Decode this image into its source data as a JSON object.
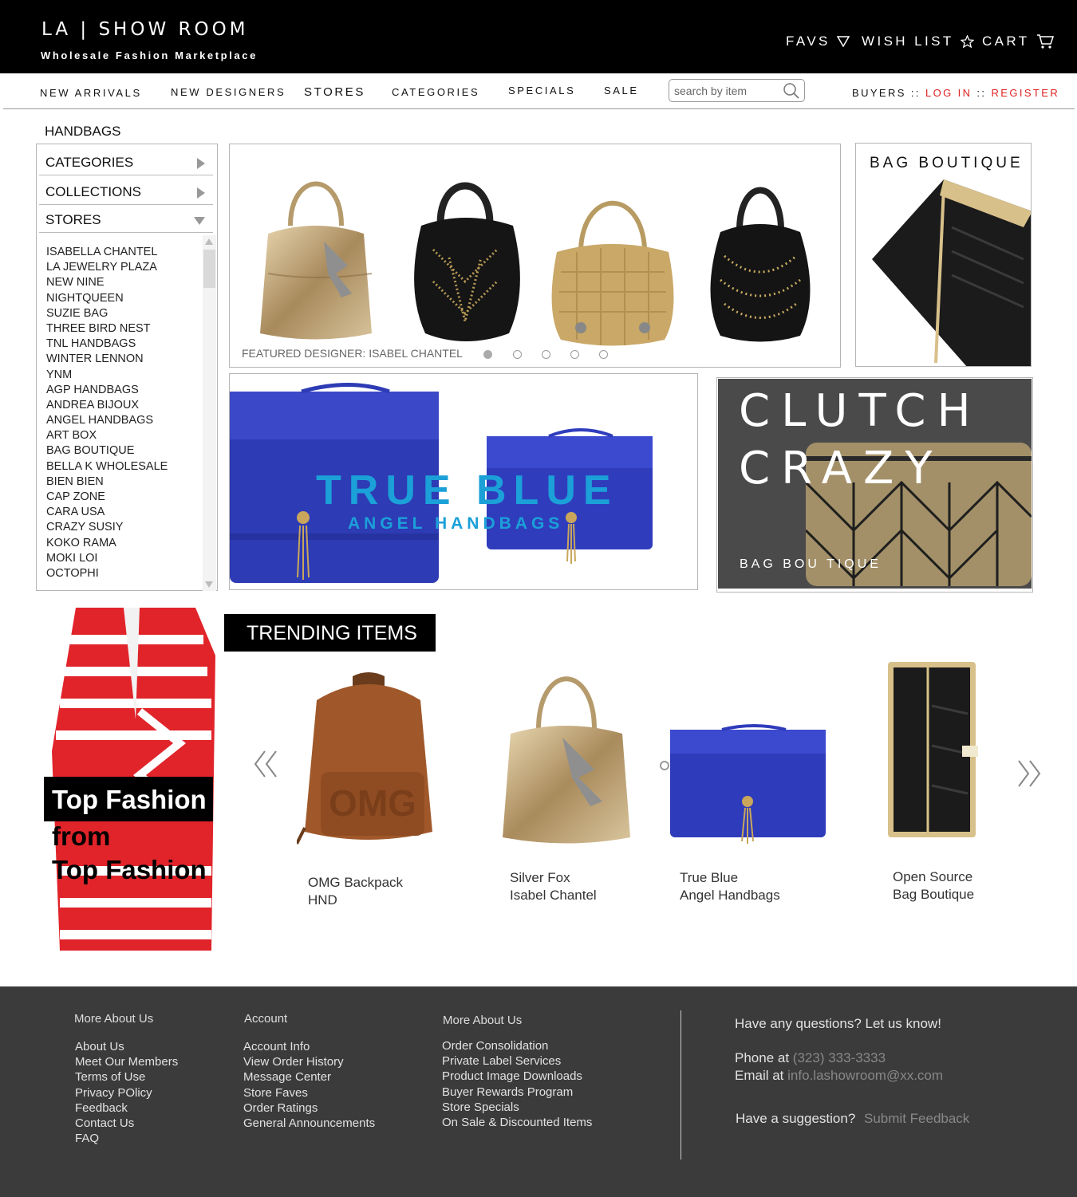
{
  "header": {
    "brand": "LA | SHOW ROOM",
    "tagline": "Wholesale Fashion Marketplace",
    "favs": "FAVS",
    "wish_list": "WISH LIST",
    "cart": "CART"
  },
  "nav": {
    "items": [
      "NEW ARRIVALS",
      "NEW DESIGNERS",
      "STORES",
      "CATEGORIES",
      "SPECIALS",
      "SALE"
    ],
    "search_placeholder": "search by item",
    "buyers": "BUYERS",
    "sep": "::",
    "login": "LOG IN",
    "register": "REGISTER"
  },
  "sidebar": {
    "page_title": "HANDBAGS",
    "sections": [
      "CATEGORIES",
      "COLLECTIONS",
      "STORES"
    ],
    "stores": [
      "ISABELLA CHANTEL",
      "LA JEWELRY PLAZA",
      "NEW NINE",
      "NIGHTQUEEN",
      "SUZIE BAG",
      "THREE BIRD NEST",
      "TNL HANDBAGS",
      "WINTER LENNON",
      "YNM",
      "AGP HANDBAGS",
      "ANDREA BIJOUX",
      "ANGEL HANDBAGS",
      "ART BOX",
      "BAG BOUTIQUE",
      "BELLA K WHOLESALE",
      "BIEN BIEN",
      "CAP ZONE",
      "CARA USA",
      "CRAZY SUSIY",
      "KOKO RAMA",
      "MOKI LOI",
      "OCTOPHI"
    ]
  },
  "featured": {
    "caption": "FEATURED DESIGNER: ISABEL CHANTEL",
    "slide_count": 5,
    "active_slide": 1
  },
  "bag_boutique": {
    "title": "BAG BOUTIQUE"
  },
  "true_blue": {
    "title": "TRUE BLUE",
    "subtitle": "ANGEL HANDBAGS"
  },
  "clutch": {
    "line1": "CLUTCH",
    "line2": "CRAZY",
    "subtitle": "BAG BOU TIQUE"
  },
  "promo": {
    "line1": "Top Fashion",
    "line2": "from",
    "line3": "Top Fashion"
  },
  "trending": {
    "label": "TRENDING ITEMS",
    "items": [
      {
        "name": "OMG Backpack",
        "store": "HND"
      },
      {
        "name": "Silver Fox",
        "store": "Isabel Chantel"
      },
      {
        "name": "True Blue",
        "store": "Angel Handbags"
      },
      {
        "name": "Open Source",
        "store": "Bag Boutique"
      }
    ]
  },
  "footer": {
    "col1": {
      "title": "More About Us",
      "links": [
        "About Us",
        "Meet Our Members",
        "Terms of Use",
        "Privacy POlicy",
        "Feedback",
        "Contact Us",
        "FAQ"
      ]
    },
    "col2": {
      "title": "Account",
      "links": [
        "Account Info",
        "View Order History",
        "Message Center",
        "Store Faves",
        "Order Ratings",
        "General Announcements"
      ]
    },
    "col3": {
      "title": "More About Us",
      "links": [
        "Order Consolidation",
        "Private Label Services",
        "Product Image Downloads",
        "Buyer Rewards Program",
        "Store Specials",
        "On Sale & Discounted Items"
      ]
    },
    "contact": {
      "question": "Have any questions?  Let us know!",
      "phone_label": "Phone at",
      "phone": "(323) 333-3333",
      "email_label": "Email at",
      "email": "info.lashowroom@xx.com",
      "suggestion": "Have a suggestion?",
      "feedback_link": "Submit Feedback"
    }
  },
  "colors": {
    "accent_red": "#e02020",
    "true_blue": "#1ba0d8",
    "footer_bg": "#3b3b3b",
    "header_bg": "#000000"
  }
}
